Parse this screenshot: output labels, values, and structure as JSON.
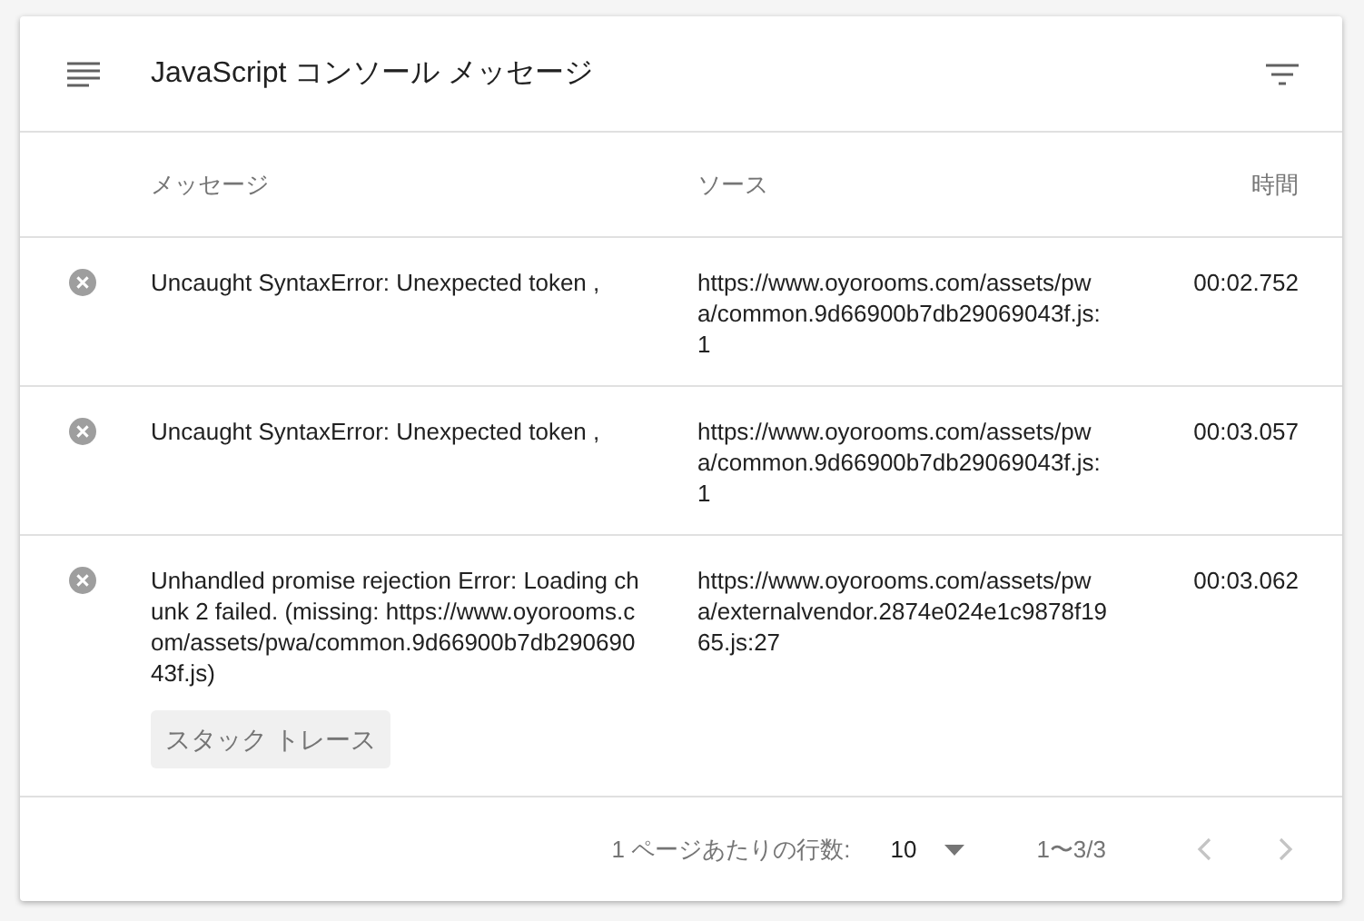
{
  "header": {
    "title": "JavaScript コンソール メッセージ"
  },
  "columns": [
    "メッセージ",
    "ソース",
    "時間"
  ],
  "rows": [
    {
      "message": "Uncaught SyntaxError: Unexpected token ,",
      "source": "https://www.oyorooms.com/assets/pwa/common.9d66900b7db29069043f.js:1",
      "time": "00:02.752"
    },
    {
      "message": "Uncaught SyntaxError: Unexpected token ,",
      "source": "https://www.oyorooms.com/assets/pwa/common.9d66900b7db29069043f.js:1",
      "time": "00:03.057"
    },
    {
      "message": "Unhandled promise rejection Error: Loading chunk 2 failed. (missing: https://www.oyorooms.com/assets/pwa/common.9d66900b7db29069043f.js)",
      "source": "https://www.oyorooms.com/assets/pwa/externalvendor.2874e024e1c9878f1965.js:27",
      "time": "00:03.062",
      "button": "スタック トレース"
    }
  ],
  "footer": {
    "rows_label": "1 ページあたりの行数:",
    "rows_per_page": "10",
    "range": "1〜3/3",
    "prev_disabled": true,
    "next_disabled": true
  }
}
